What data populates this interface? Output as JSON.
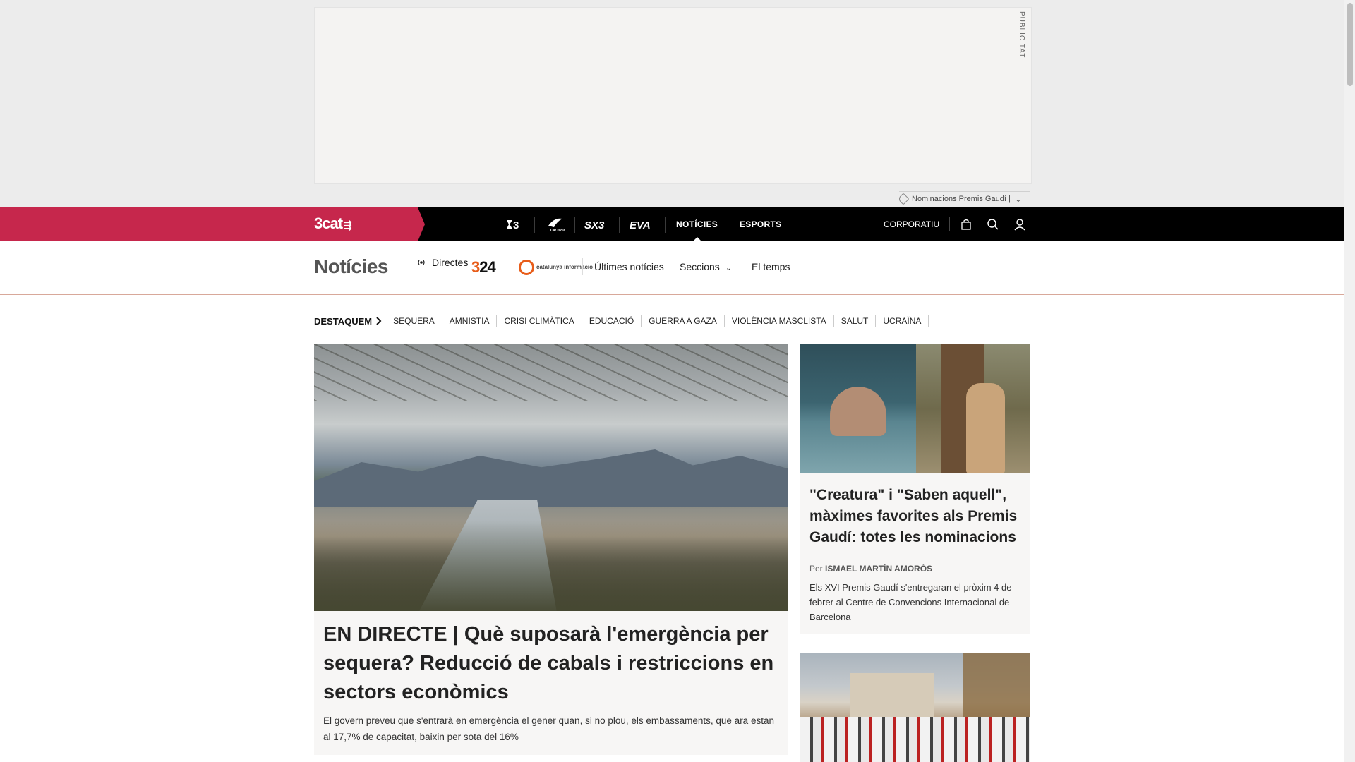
{
  "ad": {
    "label": "PUBLICITAT",
    "tag_label": "Nominacions Premis Gaudí |"
  },
  "topnav": {
    "brand": "3cat",
    "channels": [
      {
        "name": "3",
        "icon": "tv3-logo-icon"
      },
      {
        "name": "Cat ràdio",
        "icon": "catradio-logo-icon"
      },
      {
        "name": "SX3",
        "icon": "sx3-logo-icon"
      },
      {
        "name": "EVA",
        "icon": "eva-logo-icon"
      }
    ],
    "links": [
      "NOTÍCIES",
      "ESPORTS"
    ],
    "active_link": "NOTÍCIES",
    "corporate_label": "CORPORATIU",
    "utility_icons": [
      "shopping-bag-icon",
      "search-icon",
      "user-icon"
    ]
  },
  "section": {
    "title": "Notícies",
    "live_label": "Directes",
    "logo_324": "324",
    "logo_ci": "catalunya informació",
    "links": [
      "Últimes notícies",
      "Seccions",
      "El temps"
    ]
  },
  "highlights": {
    "label": "DESTAQUEM",
    "tags": [
      "SEQUERA",
      "AMNISTIA",
      "CRISI CLIMÀTICA",
      "EDUCACIÓ",
      "GUERRA A GAZA",
      "VIOLÈNCIA MASCLISTA",
      "SALUT",
      "UCRAÏNA"
    ]
  },
  "main_article": {
    "title": "EN DIRECTE | Què suposarà l'emergència per sequera? Reducció de cabals i restriccions en sectors econòmics",
    "summary": "El govern preveu que s'entrarà en emergència el gener quan, si no plou, els embassaments, que ara estan al 17,7% de capacitat, baixin per sota del 16%"
  },
  "side_article": {
    "title": "\"Creatura\" i \"Saben aquell\", màximes favorites als Premis Gaudí: totes les nominacions",
    "byline_prefix": "Per",
    "author": "ISMAEL MARTÍN AMORÓS",
    "summary": "Els XVI Premis Gaudí s'entregaran el pròxim 4 de febrer al Centre de Convencions Internacional de Barcelona"
  },
  "colors": {
    "brand": "#c6274c",
    "nav_bg": "#000000",
    "accent_324": "#e85d1a"
  }
}
